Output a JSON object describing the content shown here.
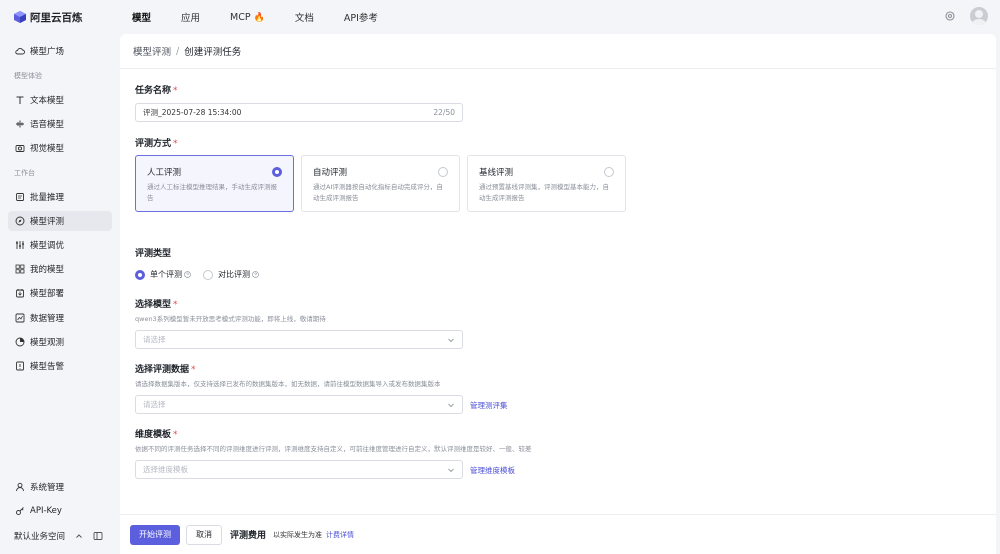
{
  "brand": {
    "name": "阿里云百炼",
    "color": "#5b5fde"
  },
  "topnav": {
    "items": [
      {
        "label": "模型",
        "active": true
      },
      {
        "label": "应用"
      },
      {
        "label": "MCP",
        "badge": "🔥"
      },
      {
        "label": "文档"
      },
      {
        "label": "API参考"
      }
    ]
  },
  "sidebar": {
    "items": [
      {
        "label": "模型广场",
        "icon": "cloud-icon"
      },
      {
        "group": "模型体验"
      },
      {
        "label": "文本模型",
        "icon": "text-icon"
      },
      {
        "label": "语音模型",
        "icon": "voice-icon"
      },
      {
        "label": "视觉模型",
        "icon": "camera-icon"
      },
      {
        "group": "工作台"
      },
      {
        "label": "批量推理",
        "icon": "batch-icon"
      },
      {
        "label": "模型评测",
        "icon": "compass-icon",
        "active": true
      },
      {
        "label": "模型调优",
        "icon": "sliders-icon"
      },
      {
        "label": "我的模型",
        "icon": "grid-icon"
      },
      {
        "label": "模型部署",
        "icon": "deploy-icon"
      },
      {
        "label": "数据管理",
        "icon": "chart-icon"
      },
      {
        "label": "模型观测",
        "icon": "pie-icon"
      },
      {
        "label": "模型告警",
        "icon": "alert-icon"
      }
    ],
    "bottom_items": [
      {
        "label": "系统管理",
        "icon": "user-icon"
      },
      {
        "label": "API-Key",
        "icon": "key-icon"
      }
    ],
    "workspace": "默认业务空间"
  },
  "breadcrumb": {
    "parent": "模型评测",
    "separator": "/",
    "current": "创建评测任务"
  },
  "form": {
    "task_name": {
      "label": "任务名称",
      "value": "评测_2025-07-28 15:34:00",
      "counter": "22/50"
    },
    "method": {
      "label": "评测方式",
      "options": [
        {
          "title": "人工评测",
          "desc": "通过人工标注模型推理结果，手动生成评测报告",
          "selected": true
        },
        {
          "title": "自动评测",
          "desc": "通过AI评测器按自动化指标自动完成评分，自动生成评测报告",
          "selected": false
        },
        {
          "title": "基线评测",
          "desc": "通过预置基线评测集，评测模型基本能力，自动生成评测报告",
          "selected": false
        }
      ]
    },
    "type": {
      "label": "评测类型",
      "options": [
        {
          "label": "单个评测",
          "selected": true
        },
        {
          "label": "对比评测",
          "selected": false
        }
      ]
    },
    "model": {
      "label": "选择模型",
      "hint": "qwen3系列模型暂未开放思考模式评测功能，即将上线，敬请期待",
      "placeholder": "请选择"
    },
    "dataset": {
      "label": "选择评测数据",
      "hint": "请选择数据集版本，仅支持选择已发布的数据集版本，如无数据，请前往模型数据集导入或发布数据集版本",
      "placeholder": "请选择",
      "link": "管理测评集"
    },
    "dimension": {
      "label": "维度模板",
      "hint": "依据不同的评测任务选择不同的评测维度进行评测，评测维度支持自定义，可前往维度管理进行自定义，默认评测维度是较好、一般、较差",
      "placeholder": "选择维度模板",
      "link": "管理维度模板"
    }
  },
  "footer": {
    "submit": "开始评测",
    "cancel": "取消",
    "fee_label": "评测费用",
    "fee_note": "以实际发生为准",
    "fee_link": "计费详情"
  }
}
